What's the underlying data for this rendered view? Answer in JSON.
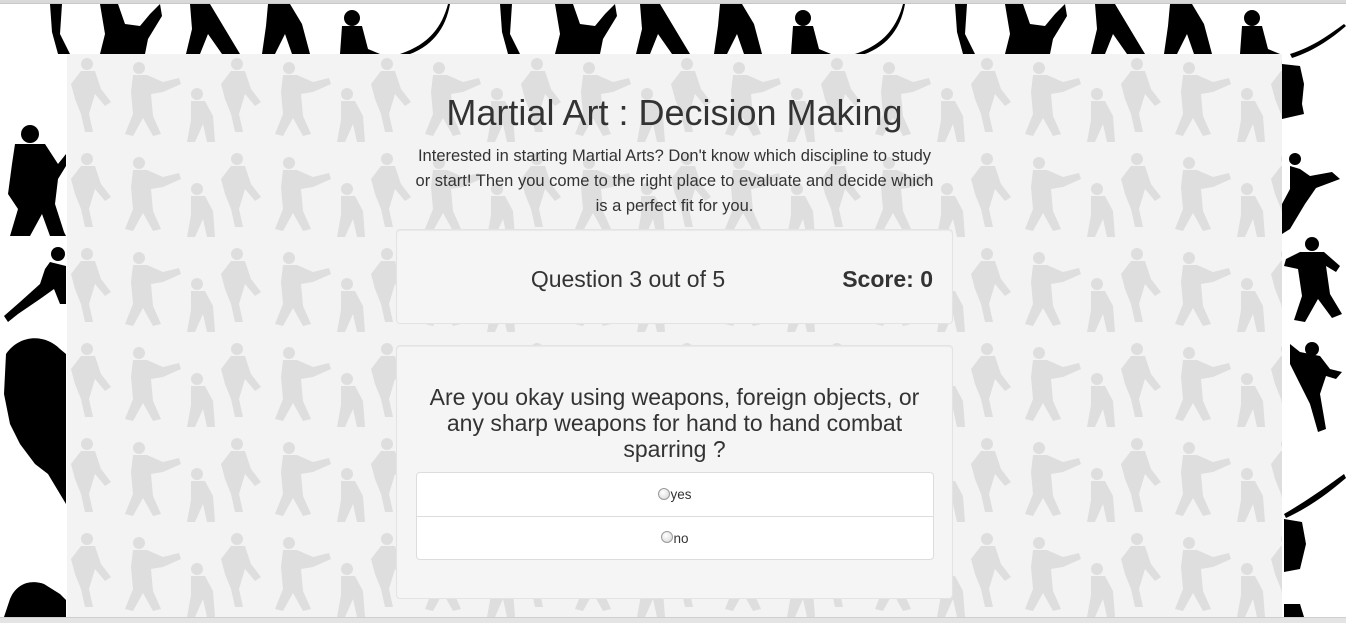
{
  "page": {
    "title": "Martial Art : Decision Making",
    "intro": "Interested in starting Martial Arts? Don't know which discipline to study or start! Then you come to the right place to evaluate and decide which is a perfect fit for you."
  },
  "status": {
    "question_counter": "Question 3 out of 5",
    "score_label": "Score:",
    "score_value": "0"
  },
  "question": {
    "text": "Are you okay using weapons, foreign objects, or any sharp weapons for hand to hand combat sparring ?",
    "answers": [
      {
        "label": "yes",
        "selected": false
      },
      {
        "label": "no",
        "selected": false
      }
    ]
  },
  "theme": {
    "silhouette_color": "#000000",
    "panel_color": "#f3f3f3",
    "faded_silhouette_color": "#dedede",
    "icon": "martial-artist-silhouette-icon"
  }
}
